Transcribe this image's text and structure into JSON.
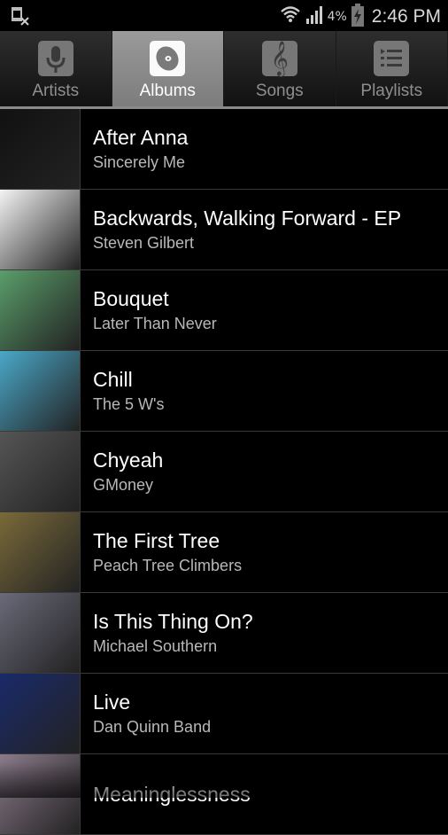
{
  "status_bar": {
    "left_icon": "sim-card-missing-icon",
    "icons": [
      "wifi-icon",
      "signal-icon",
      "battery-charging-icon"
    ],
    "battery_percent": "4%",
    "time": "2:46 PM"
  },
  "tabs": [
    {
      "label": "Artists",
      "icon": "microphone-icon",
      "active": false
    },
    {
      "label": "Albums",
      "icon": "disc-icon",
      "active": true
    },
    {
      "label": "Songs",
      "icon": "treble-clef-icon",
      "active": false
    },
    {
      "label": "Playlists",
      "icon": "list-icon",
      "active": false
    }
  ],
  "albums": [
    {
      "title": "After Anna",
      "artist": "Sincerely Me",
      "art_color": "#111111"
    },
    {
      "title": "Backwards, Walking Forward - EP",
      "artist": "Steven Gilbert",
      "art_color": "#f4f4f4"
    },
    {
      "title": "Bouquet",
      "artist": "Later Than Never",
      "art_color": "#5a9e6a"
    },
    {
      "title": "Chill",
      "artist": "The 5 W's",
      "art_color": "#4aa8c8"
    },
    {
      "title": "Chyeah",
      "artist": "GMoney",
      "art_color": "#555555"
    },
    {
      "title": "The First Tree",
      "artist": "Peach Tree Climbers",
      "art_color": "#7a6a3a"
    },
    {
      "title": "Is This Thing On?",
      "artist": "Michael Southern",
      "art_color": "#6a6a7a"
    },
    {
      "title": "Live",
      "artist": "Dan Quinn Band",
      "art_color": "#1a2a6a"
    },
    {
      "title": "Meaninglessness",
      "artist": "",
      "art_color": "#8a7a8a"
    }
  ]
}
